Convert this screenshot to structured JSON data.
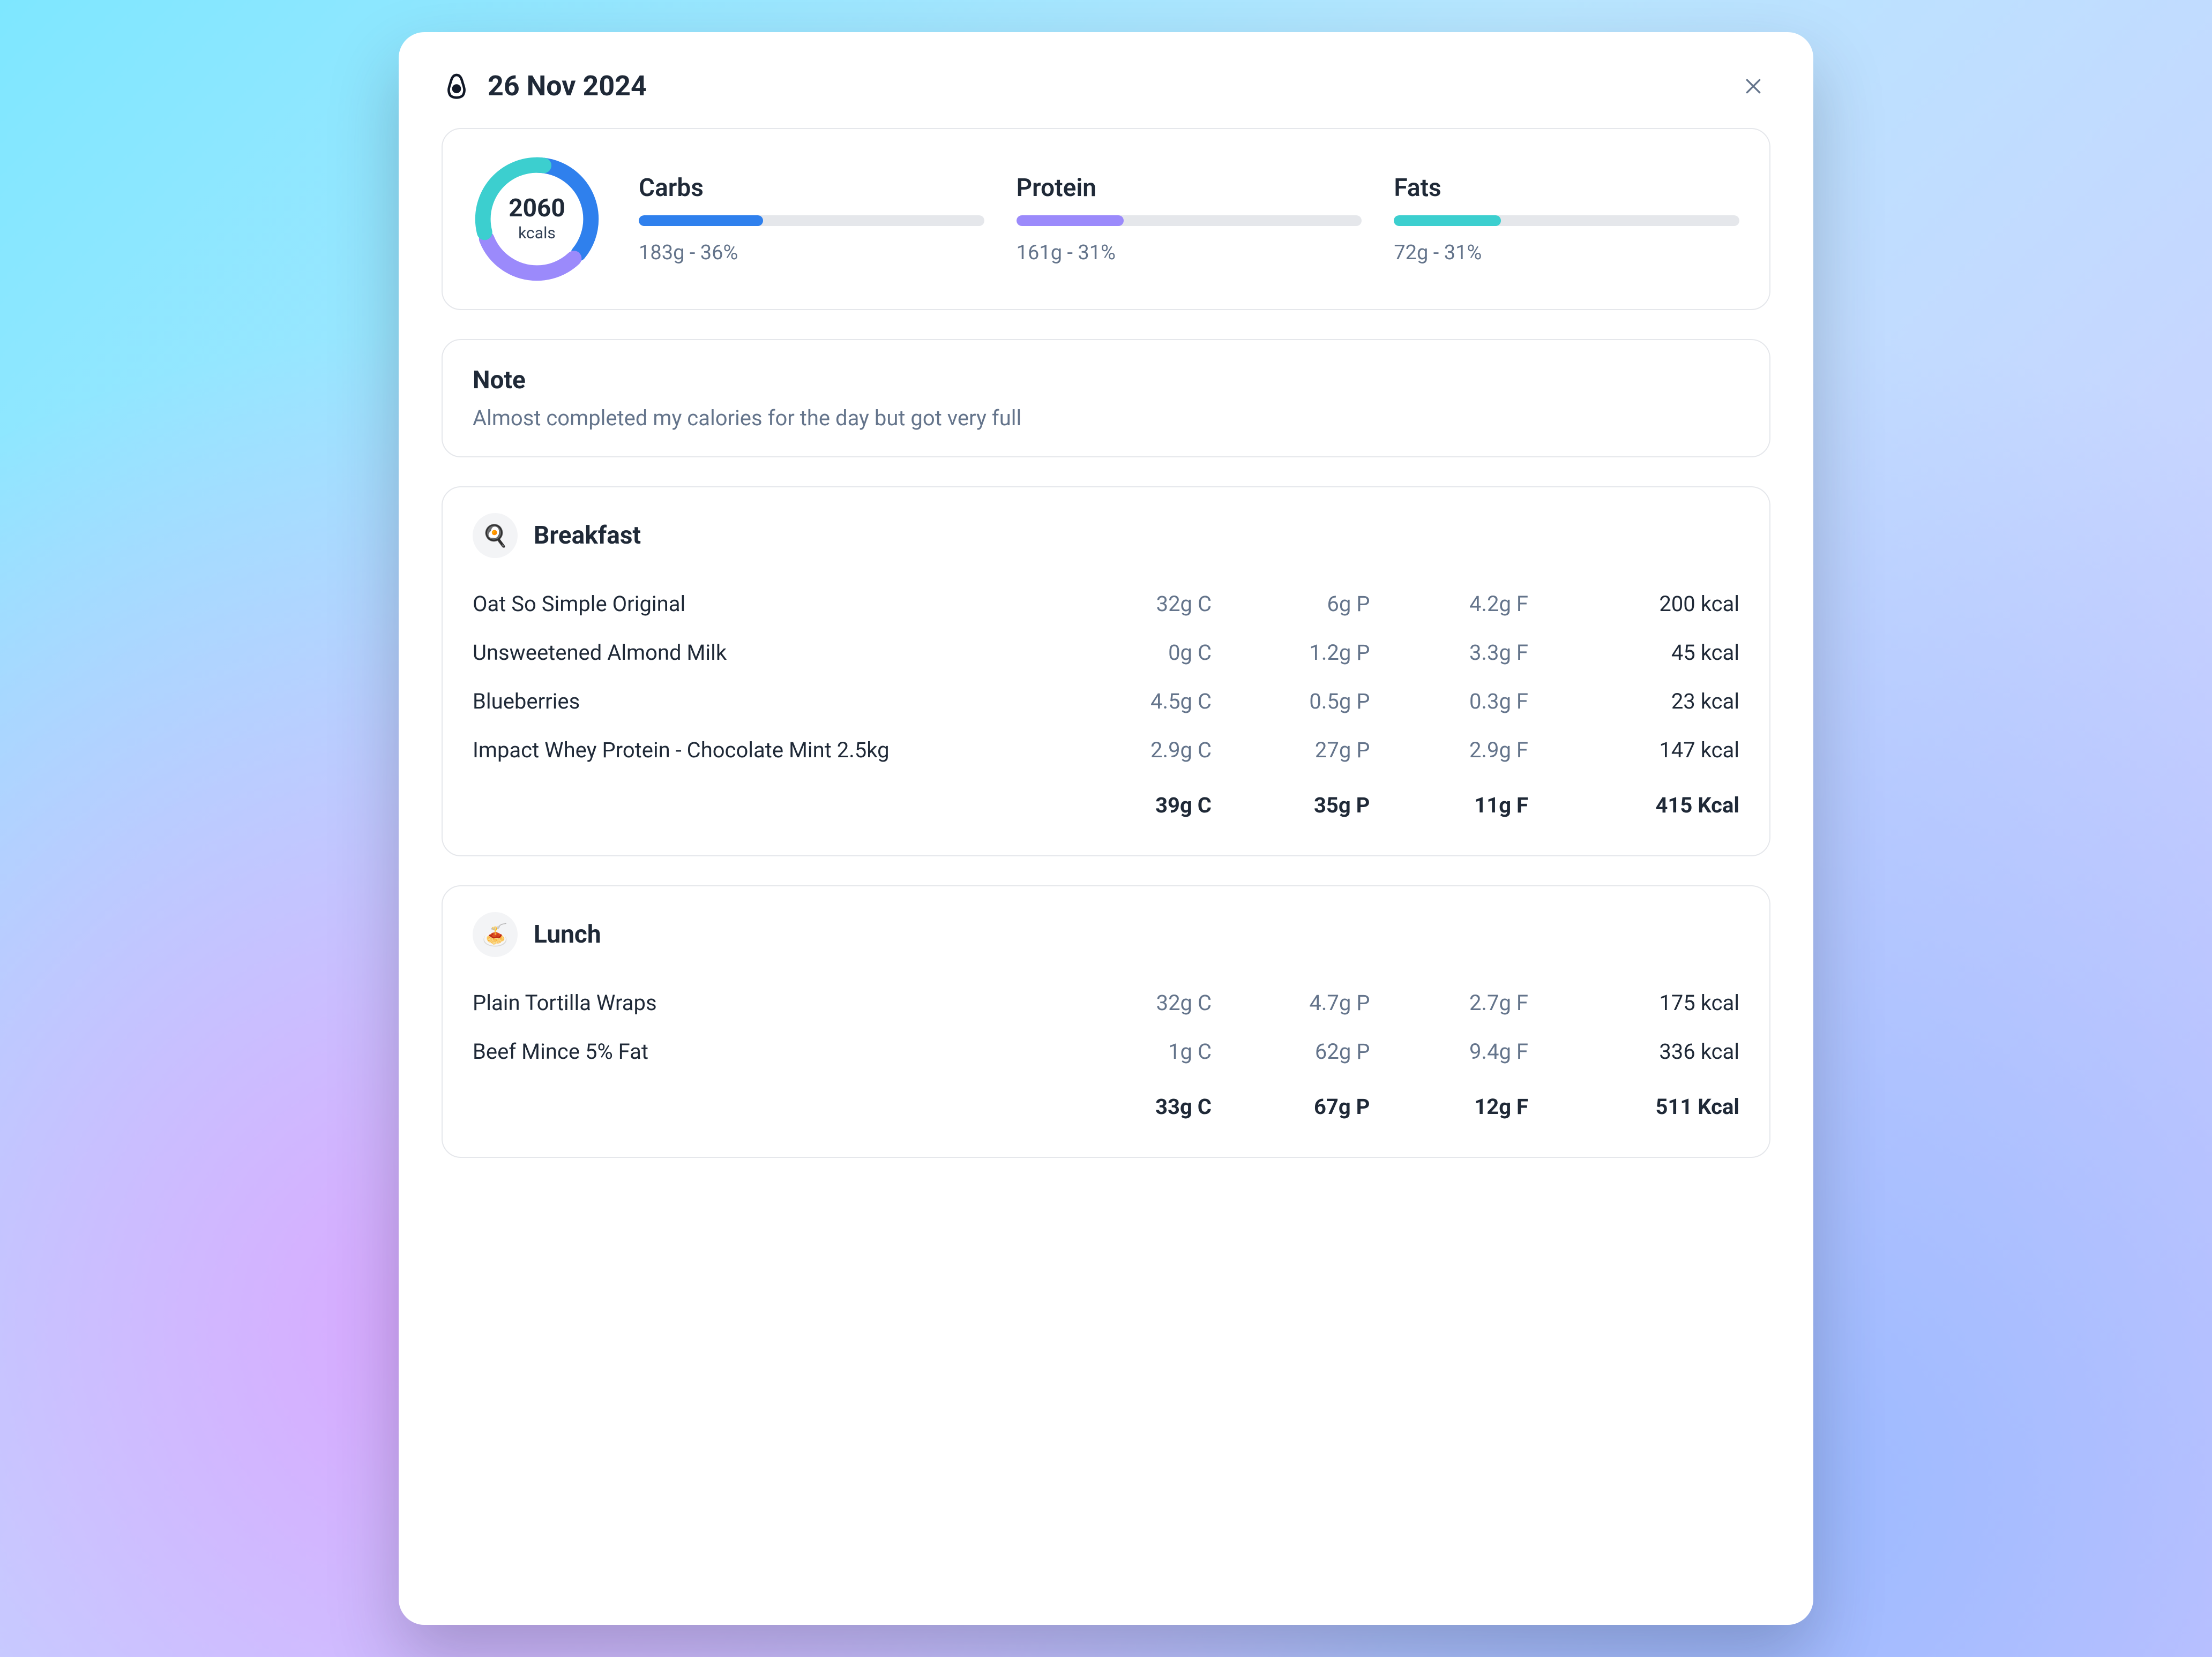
{
  "header": {
    "date": "26 Nov 2024"
  },
  "summary": {
    "calories_value": "2060",
    "calories_unit": "kcals",
    "ring_segments": {
      "carbs_pct": 36,
      "protein_pct": 31,
      "fats_pct": 31,
      "gap_pct": 2
    },
    "macros": [
      {
        "key": "carbs",
        "label": "Carbs",
        "detail": "183g - 36%",
        "fill_pct": 36
      },
      {
        "key": "protein",
        "label": "Protein",
        "detail": "161g - 31%",
        "fill_pct": 31
      },
      {
        "key": "fats",
        "label": "Fats",
        "detail": "72g - 31%",
        "fill_pct": 31
      }
    ]
  },
  "note": {
    "title": "Note",
    "body": "Almost completed my calories for the day but got very full"
  },
  "meals": [
    {
      "icon": "🍳",
      "title": "Breakfast",
      "items": [
        {
          "name": "Oat So Simple Original",
          "c": "32g C",
          "p": "6g P",
          "f": "4.2g F",
          "kcal": "200 kcal"
        },
        {
          "name": "Unsweetened Almond Milk",
          "c": "0g C",
          "p": "1.2g P",
          "f": "3.3g F",
          "kcal": "45 kcal"
        },
        {
          "name": "Blueberries",
          "c": "4.5g C",
          "p": "0.5g P",
          "f": "0.3g F",
          "kcal": "23 kcal"
        },
        {
          "name": "Impact Whey Protein - Chocolate Mint 2.5kg",
          "c": "2.9g C",
          "p": "27g P",
          "f": "2.9g F",
          "kcal": "147 kcal"
        }
      ],
      "total": {
        "c": "39g C",
        "p": "35g P",
        "f": "11g F",
        "kcal": "415 Kcal"
      }
    },
    {
      "icon": "🍝",
      "title": "Lunch",
      "items": [
        {
          "name": "Plain Tortilla Wraps",
          "c": "32g C",
          "p": "4.7g P",
          "f": "2.7g F",
          "kcal": "175 kcal"
        },
        {
          "name": "Beef Mince 5% Fat",
          "c": "1g C",
          "p": "62g P",
          "f": "9.4g F",
          "kcal": "336 kcal"
        }
      ],
      "total": {
        "c": "33g C",
        "p": "67g P",
        "f": "12g F",
        "kcal": "511 Kcal"
      }
    }
  ],
  "colors": {
    "carbs": "#2f80ed",
    "protein": "#9b8afb",
    "fats": "#3ccfcf"
  }
}
